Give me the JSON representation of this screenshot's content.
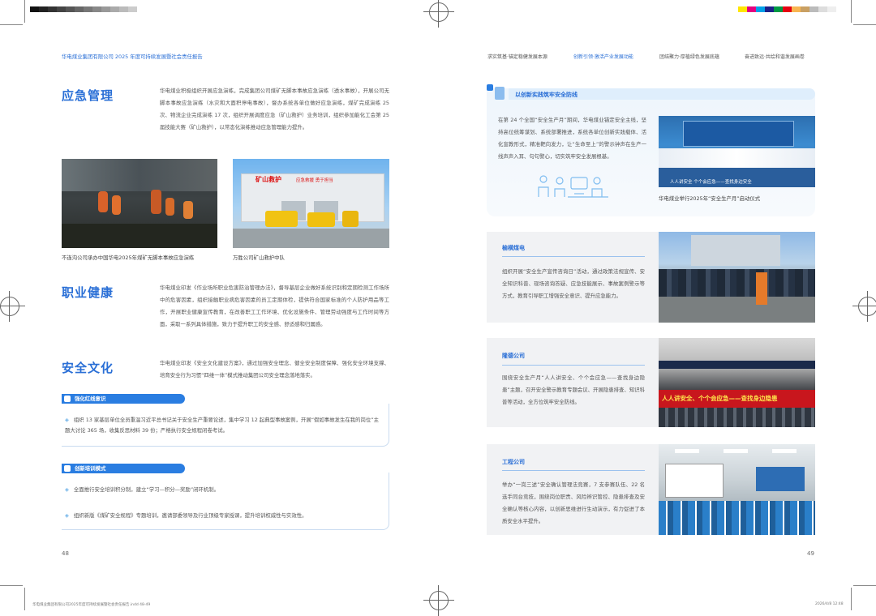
{
  "header_left": "华电煤业集团有限公司 2025 年度可持续发展暨社会责任报告",
  "nav": [
    "求实筑基·锚定稳健发展本源",
    "创新引领·激活产业发展动能",
    "团结聚力·厚植绿色发展底蕴",
    "奋进致远·共绘和谐发展画卷"
  ],
  "colors": {
    "accent": "#2a6fd6",
    "pill": "#2a7de1",
    "card_bg": "#f1f2f4"
  },
  "left": {
    "emergency": {
      "title": "应急管理",
      "text": "华电煤业积极组织开展应急演练，完成集团公司煤矿无脚本事故应急演练（透水事故），开展公司无脚本事故应急演练（水灾和大面积停电事故），督办系统各单位做好应急演练，煤矿完成演练 25 次、物流企业完成演练 17 次，组织开展调度应急（矿山救护）业务培训，组织参加能化工会第 25 届技能大赛（矿山救护），以常态化演练推动应急管理能力提升。",
      "cap1": "不连沟公司承办中国华电2025年煤矿无脚本事故应急演练",
      "cap2": "万胜公司矿山救护中队",
      "sign1": "矿山救护",
      "sign2": "应急救援 勇于担当"
    },
    "health": {
      "title": "职业健康",
      "text": "华电煤业印发《作业场所职业危害防治管理办法》，督导基层企业做好系统识别和定期检测工作场所中的危害因素，组织接触职业病危害因素的员工定期体检，提供符合国家标准的个人防护用品等工作，开展职业健康宣传教育，在改善职工工作环境、优化设施条件、管理劳动强度与工作时间等方面，采取一系列具体措施，致力于提升职工的安全感、舒适感和归属感。"
    },
    "culture": {
      "title": "安全文化",
      "text": "华电煤业印发《安全文化建设方案》，通过加强安全理念、健全安全制度保障、强化安全环境支撑、培育安全行为习惯“四维一体”模式推动集团公司安全理念落地落实。",
      "pill1": "强化红线意识",
      "bullet1": "组织 13 家基层单位全员重温习近平总书记关于安全生产重要论述，集中学习 12 起典型事故案例，开展“假如事故发生在我的岗位”主题大讨论 365 场，收集反思材料 39 份；严格执行安全规程闭卷考试。",
      "pill2": "创新培训模式",
      "bullet2": "全面推行安全培训积分制，建立“学习—积分—奖励”闭环机制。",
      "bullet3": "组织新版《煤矿安全规程》专题培训，邀请部委领导及行业顶级专家授课，提升培训权威性与实效性。"
    },
    "page_num": "48"
  },
  "right": {
    "banner": "以创新实践筑牢安全防线",
    "intro": "在第 24 个全国“安全生产月”期间，华电煤业锚定安全主线，坚持高位统筹谋划、系统部署推进，系统各单位创新实践载体、活化宣教形式，精准靶向发力，让“生命至上”的警示钟声在生产一线声声入耳、句句警心，切实筑牢安全发展根基。",
    "intro_caption": "华电煤业举行2025年“安全生产月”启动仪式",
    "stage_text": "人人讲安全  个个会应急——查找身边安全",
    "cards": [
      {
        "title": "榆横煤电",
        "text": "组织开展“安全生产宣传咨询日”活动，通过政策法规宣传、安全知识科普、现场咨询答疑、应急技能展示、事故案例警示等方式，教育引导职工增强安全意识、提升应急能力。"
      },
      {
        "title": "隆德公司",
        "text": "围绕安全生产月“人人讲安全、个个会应急——查找身边隐患”主题，召开安全警示教育专题会议、开展隐患排查、知识科普等活动，全方位筑牢安全防线。",
        "photo_text": "人人讲安全、个个会应急——查找身边隐患"
      },
      {
        "title": "工程公司",
        "text": "举办“一岗三述”安全确认管理法竞赛，7 支参赛队伍、22 名选手同台竞技，围绕岗位职责、风险辨识管控、隐患排查及安全确认等核心内容，以创新思维进行生动演示，有力促进了本质安全水平提升。"
      }
    ],
    "page_num": "49"
  },
  "footer_left": "华电煤业集团有限公司2025年度可持续发展暨社会责任报告.indd  48-49",
  "footer_right": "2026/4/8   12:48"
}
